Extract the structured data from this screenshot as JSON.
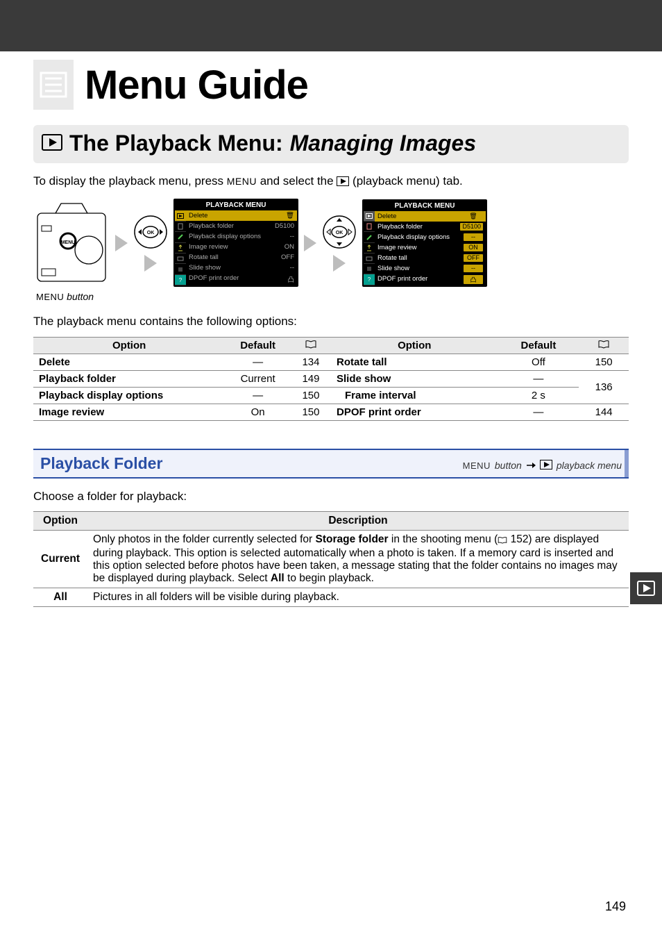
{
  "chapter": {
    "title": "Menu Guide"
  },
  "section": {
    "title_main": "The Playback Menu:",
    "title_sub": "Managing Images"
  },
  "intro": {
    "pre": "To display the playback menu, press ",
    "menu_label": "MENU",
    "mid": " and select the ",
    "post": " (playback menu) tab."
  },
  "caption": {
    "label": " button",
    "menu_label": "MENU"
  },
  "options_intro": "The playback menu contains the following options:",
  "options_headers": {
    "option": "Option",
    "default": "Default"
  },
  "options_left": [
    {
      "name": "Delete",
      "default": "—",
      "page": "134"
    },
    {
      "name": "Playback folder",
      "default": "Current",
      "page": "149"
    },
    {
      "name": "Playback display options",
      "default": "—",
      "page": "150"
    },
    {
      "name": "Image review",
      "default": "On",
      "page": "150"
    }
  ],
  "options_right": [
    {
      "name": "Rotate tall",
      "default": "Off",
      "page": "150",
      "indent": false
    },
    {
      "name": "Slide show",
      "default": "—",
      "page": "136",
      "indent": false,
      "rowspan": true
    },
    {
      "name": "Frame interval",
      "default": "2 s",
      "page": "",
      "indent": true
    },
    {
      "name": "DPOF print order",
      "default": "—",
      "page": "144",
      "indent": false
    }
  ],
  "subsection": {
    "title": "Playback Folder",
    "nav_menu": "MENU",
    "nav_button": " button",
    "nav_playback": " playback menu"
  },
  "folder_intro": "Choose a folder for playback:",
  "desc_headers": {
    "option": "Option",
    "description": "Description"
  },
  "desc_rows": [
    {
      "option": "Current",
      "text_pre": "Only photos in the folder currently selected for ",
      "bold1": "Storage folder",
      "text_mid1": " in the shooting menu (",
      "page_ref": " 152) are displayed during playback.  This option is selected automatically when a photo is taken.  If a memory card is inserted and this option selected before photos have been taken, a message stating that the folder contains no images may be displayed during playback.  Select ",
      "bold2": "All",
      "text_post": " to begin playback."
    },
    {
      "option": "All",
      "text": "Pictures in all folders will be visible during playback."
    }
  ],
  "mini_screen": {
    "title": "PLAYBACK MENU",
    "rows": [
      {
        "label": "Delete",
        "val": "🗑"
      },
      {
        "label": "Playback folder",
        "val": "D5100"
      },
      {
        "label": "Playback display options",
        "val": "--"
      },
      {
        "label": "Image review",
        "val": "ON"
      },
      {
        "label": "Rotate tall",
        "val": "OFF"
      },
      {
        "label": "Slide show",
        "val": "--"
      },
      {
        "label": "DPOF print order",
        "val": "凸"
      }
    ]
  },
  "page_number": "149"
}
